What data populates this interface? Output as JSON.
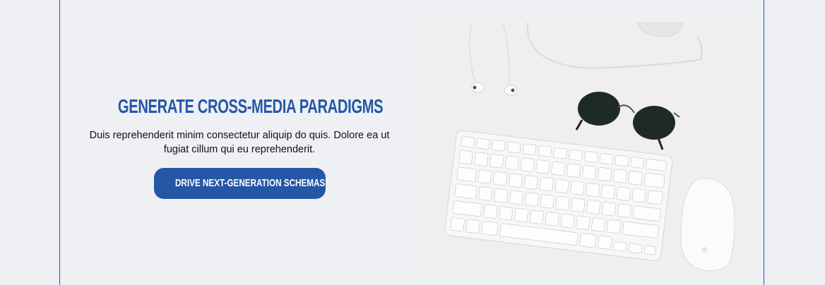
{
  "section": {
    "heading": "Generate cross-media paradigms",
    "description": "Duis reprehenderit minim consectetur aliquip do quis. Dolore ea ut fugiat cillum qui eu reprehenderit.",
    "cta_label": "Drive next-generation schemas"
  },
  "image": {
    "subject": "keyboard-sunglasses-earphones-mouse-desk"
  },
  "colors": {
    "accent": "#2557a7",
    "background": "#eef0f3",
    "border": "#2b58a6"
  }
}
